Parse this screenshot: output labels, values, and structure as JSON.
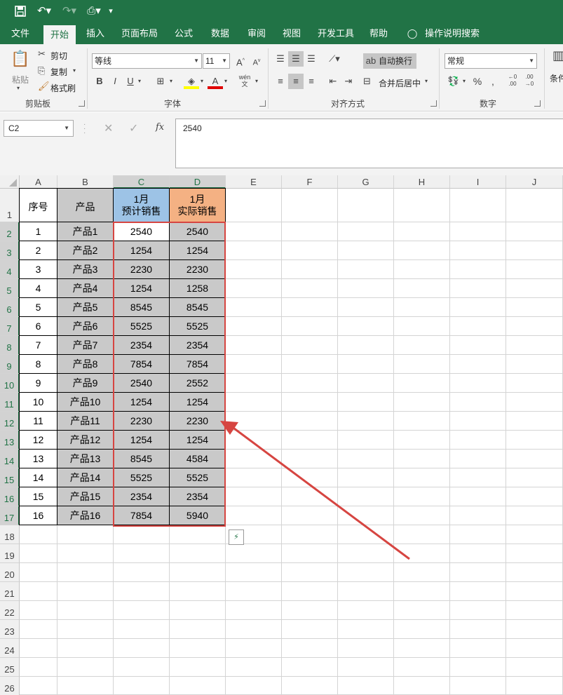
{
  "qat": {
    "save_icon": "save-icon",
    "undo_icon": "undo-icon",
    "redo_icon": "redo-icon",
    "form_icon": "form-icon",
    "customize_icon": "chevron-down-icon"
  },
  "tabs": [
    {
      "label": "文件"
    },
    {
      "label": "开始"
    },
    {
      "label": "插入"
    },
    {
      "label": "页面布局"
    },
    {
      "label": "公式"
    },
    {
      "label": "数据"
    },
    {
      "label": "审阅"
    },
    {
      "label": "视图"
    },
    {
      "label": "开发工具"
    },
    {
      "label": "帮助"
    },
    {
      "label": "操作说明搜索"
    }
  ],
  "ribbon": {
    "clipboard": {
      "paste": "粘贴",
      "cut": "剪切",
      "copy": "复制",
      "format_painter": "格式刷",
      "label": "剪贴板"
    },
    "font": {
      "name": "等线",
      "size": "11",
      "bold": "B",
      "italic": "I",
      "underline": "U",
      "label": "字体"
    },
    "alignment": {
      "wrap": "自动换行",
      "merge": "合并后居中",
      "label": "对齐方式"
    },
    "number": {
      "format": "常规",
      "percent": "%",
      "comma": ",",
      "label": "数字"
    },
    "styles": {
      "conditional": "条件"
    }
  },
  "formula_bar": {
    "name_box": "C2",
    "fx": "fx",
    "value": "2540"
  },
  "columns": [
    "A",
    "B",
    "C",
    "D",
    "E",
    "F",
    "G",
    "H",
    "I",
    "J"
  ],
  "rows": [
    "1",
    "2",
    "3",
    "4",
    "5",
    "6",
    "7",
    "8",
    "9",
    "10",
    "11",
    "12",
    "13",
    "14",
    "15",
    "16",
    "17",
    "18",
    "19",
    "20",
    "21",
    "22",
    "23",
    "24",
    "25",
    "26"
  ],
  "table": {
    "header": {
      "seq": "序号",
      "product": "产品",
      "plan_month": "1月",
      "plan_label": "预计销售",
      "actual_month": "1月",
      "actual_label": "实际销售"
    },
    "rows": [
      [
        "1",
        "产品1",
        "2540",
        "2540"
      ],
      [
        "2",
        "产品2",
        "1254",
        "1254"
      ],
      [
        "3",
        "产品3",
        "2230",
        "2230"
      ],
      [
        "4",
        "产品4",
        "1254",
        "1258"
      ],
      [
        "5",
        "产品5",
        "8545",
        "8545"
      ],
      [
        "6",
        "产品6",
        "5525",
        "5525"
      ],
      [
        "7",
        "产品7",
        "2354",
        "2354"
      ],
      [
        "8",
        "产品8",
        "7854",
        "7854"
      ],
      [
        "9",
        "产品9",
        "2540",
        "2552"
      ],
      [
        "10",
        "产品10",
        "1254",
        "1254"
      ],
      [
        "11",
        "产品11",
        "2230",
        "2230"
      ],
      [
        "12",
        "产品12",
        "1254",
        "1254"
      ],
      [
        "13",
        "产品13",
        "8545",
        "4584"
      ],
      [
        "14",
        "产品14",
        "5525",
        "5525"
      ],
      [
        "15",
        "产品15",
        "2354",
        "2354"
      ],
      [
        "16",
        "产品16",
        "7854",
        "5940"
      ]
    ]
  },
  "colors": {
    "excel_green": "#217346",
    "plan_header": "#9dc3e6",
    "actual_header": "#f4b183",
    "selection_gray": "#c9c9c9",
    "annotation_red": "#d64541"
  }
}
